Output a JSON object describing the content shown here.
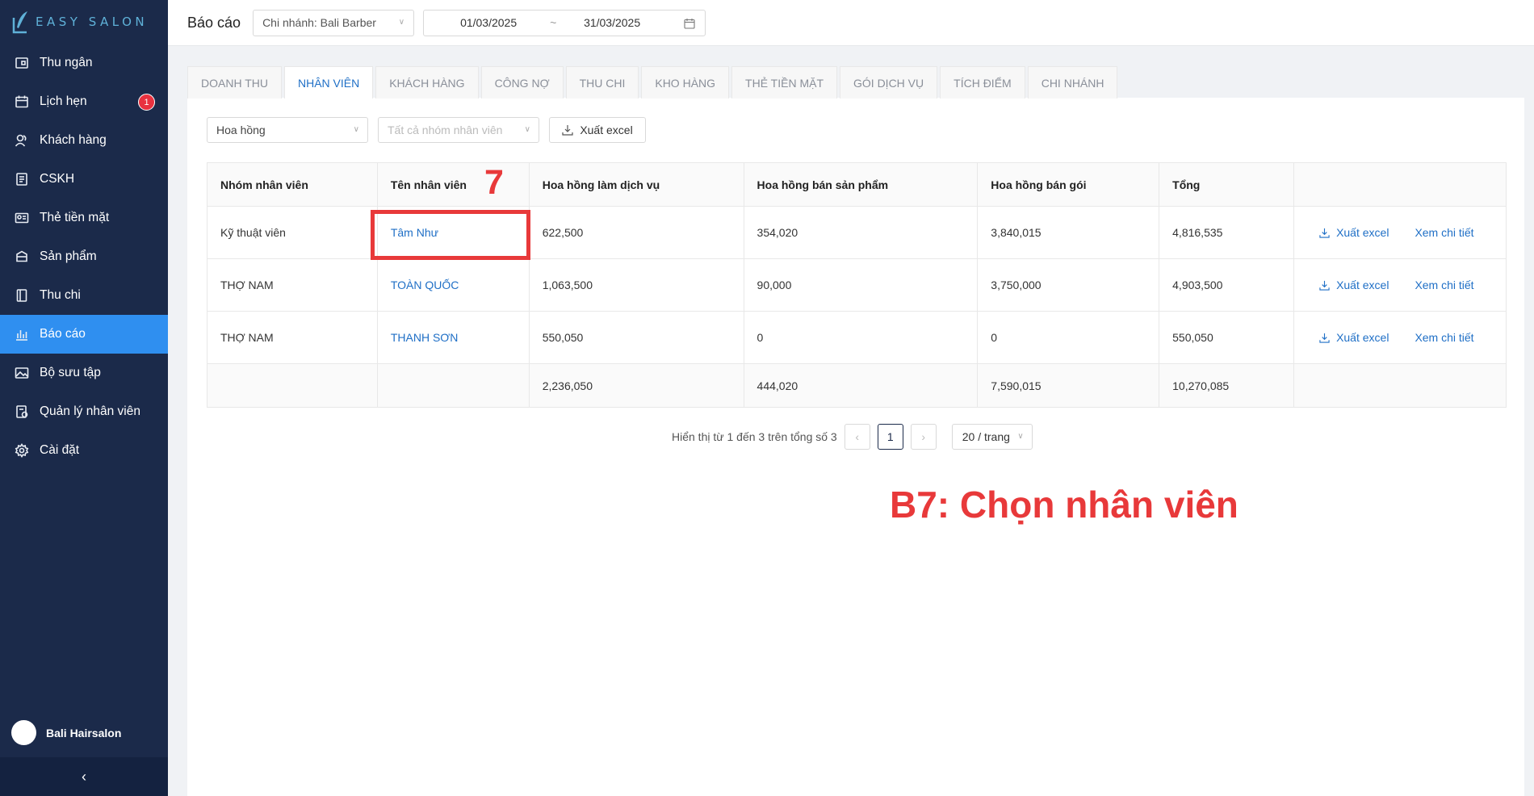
{
  "app": {
    "logo_text": "EASY SALON"
  },
  "sidebar": {
    "items": [
      {
        "label": "Thu ngân",
        "icon": "cashier-icon"
      },
      {
        "label": "Lịch hẹn",
        "icon": "calendar-icon",
        "badge": "1"
      },
      {
        "label": "Khách hàng",
        "icon": "customers-icon"
      },
      {
        "label": "CSKH",
        "icon": "customer-care-icon"
      },
      {
        "label": "Thẻ tiền mặt",
        "icon": "cash-card-icon"
      },
      {
        "label": "Sản phẩm",
        "icon": "product-icon"
      },
      {
        "label": "Thu chi",
        "icon": "book-icon"
      },
      {
        "label": "Báo cáo",
        "icon": "report-chart-icon",
        "active": true
      },
      {
        "label": "Bộ sưu tập",
        "icon": "gallery-icon"
      },
      {
        "label": "Quản lý nhân viên",
        "icon": "staff-management-icon"
      },
      {
        "label": "Cài đặt",
        "icon": "gear-icon"
      }
    ],
    "user_name": "Bali Hairsalon",
    "collapse_glyph": "‹"
  },
  "header": {
    "title": "Báo cáo",
    "branch_select": "Chi nhánh: Bali Barber",
    "date_from": "01/03/2025",
    "date_separator": "~",
    "date_to": "31/03/2025"
  },
  "tabs": [
    {
      "label": "DOANH THU"
    },
    {
      "label": "NHÂN VIÊN",
      "active": true
    },
    {
      "label": "KHÁCH HÀNG"
    },
    {
      "label": "CÔNG NỢ"
    },
    {
      "label": "THU CHI"
    },
    {
      "label": "KHO HÀNG"
    },
    {
      "label": "THẺ TIỀN MẶT"
    },
    {
      "label": "GÓI DỊCH VỤ"
    },
    {
      "label": "TÍCH ĐIỂM"
    },
    {
      "label": "CHI NHÁNH"
    }
  ],
  "toolbar": {
    "report_type": "Hoa hồng",
    "group_placeholder": "Tất cả nhóm nhân viên",
    "export_label": "Xuất excel"
  },
  "table": {
    "headers": [
      "Nhóm nhân viên",
      "Tên nhân viên",
      "Hoa hồng làm dịch vụ",
      "Hoa hồng bán sản phẩm",
      "Hoa hồng bán gói",
      "Tổng",
      ""
    ],
    "rows": [
      {
        "group": "Kỹ thuật viên",
        "name": "Tâm Như",
        "service": "622,500",
        "product": "354,020",
        "package": "3,840,015",
        "total": "4,816,535"
      },
      {
        "group": "THỢ NAM",
        "name": "TOÀN QUỐC",
        "service": "1,063,500",
        "product": "90,000",
        "package": "3,750,000",
        "total": "4,903,500"
      },
      {
        "group": "THỢ NAM",
        "name": "THANH SƠN",
        "service": "550,050",
        "product": "0",
        "package": "0",
        "total": "550,050"
      }
    ],
    "row_export_label": "Xuất excel",
    "row_detail_label": "Xem chi tiết",
    "totals": {
      "service": "2,236,050",
      "product": "444,020",
      "package": "7,590,015",
      "total": "10,270,085"
    }
  },
  "pagination": {
    "summary": "Hiển thị từ 1 đến 3 trên tổng số 3",
    "prev": "‹",
    "current_page": "1",
    "next": "›",
    "page_size": "20 / trang"
  },
  "annotation": {
    "step_number": "7",
    "caption": "B7: Chọn nhân viên",
    "color": "#e8393a"
  },
  "colors": {
    "sidebar": "#1b2a4a",
    "active": "#2f8ff0",
    "link": "#1f6fc6"
  }
}
